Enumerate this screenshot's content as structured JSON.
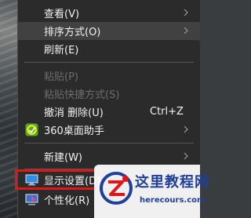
{
  "menu": {
    "view": "查看(V)",
    "sort": "排序方式(O)",
    "refresh": "刷新(E)",
    "paste": "粘贴(P)",
    "paste_shortcut": "粘贴快捷方式(S)",
    "undo": "撤消 删除(U)",
    "undo_shortcut": "Ctrl+Z",
    "assistant": "360桌面助手",
    "new": "新建(W)",
    "display": "显示设置(D)",
    "personalize": "个性化(R)"
  },
  "watermark": {
    "title": "这里教程网",
    "url": "herecours.com"
  },
  "colors": {
    "menu_bg": "#2b2b2b",
    "highlight": "#414141",
    "disabled_text": "#6d6d6d",
    "emphasis_box": "#e01717",
    "watermark_blue": "#1f3f9a"
  }
}
